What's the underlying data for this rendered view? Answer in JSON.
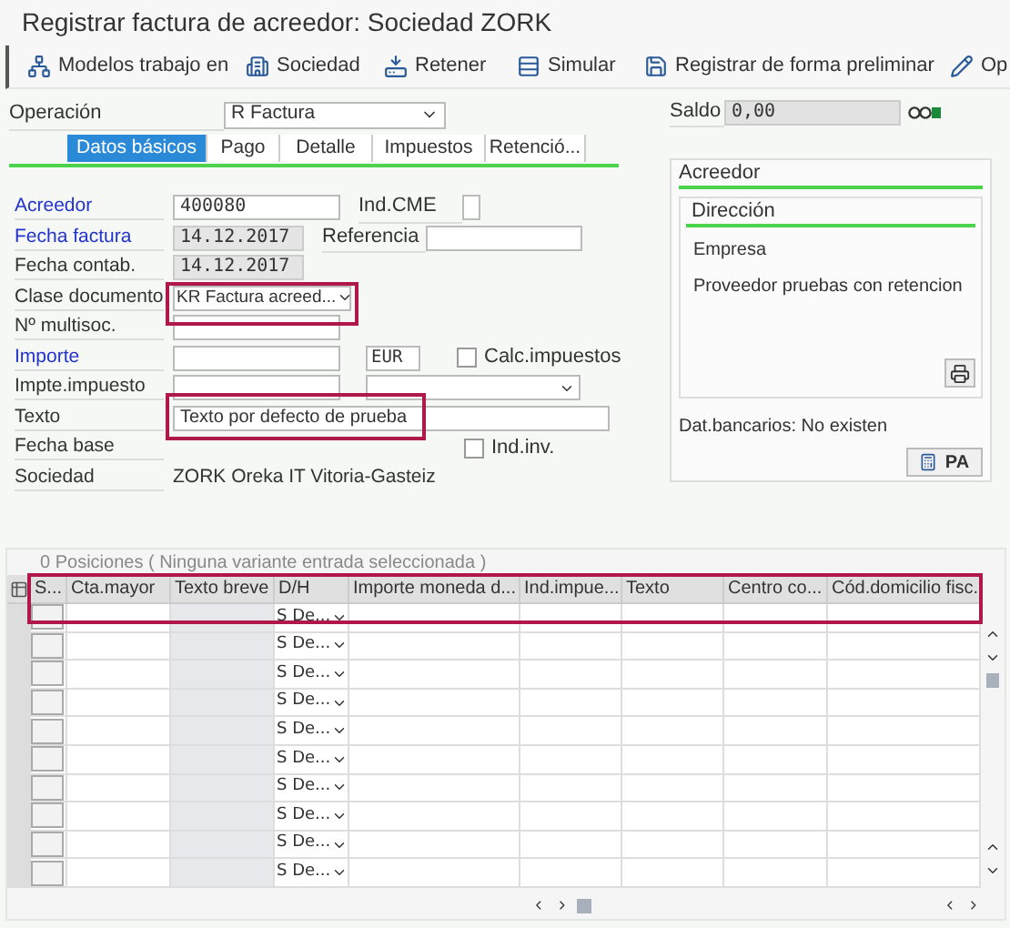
{
  "window": {
    "title": "Registrar factura de acreedor: Sociedad ZORK"
  },
  "toolbar": [
    {
      "label": "Modelos trabajo en"
    },
    {
      "label": "Sociedad"
    },
    {
      "label": "Retener"
    },
    {
      "label": "Simular"
    },
    {
      "label": "Registrar de forma preliminar"
    },
    {
      "label": "Op"
    }
  ],
  "operation": {
    "label": "Operación",
    "value": "R Factura"
  },
  "saldo": {
    "label": "Saldo",
    "value": "0,00"
  },
  "tabs": [
    {
      "label": "Datos básicos",
      "selected": true
    },
    {
      "label": "Pago",
      "selected": false
    },
    {
      "label": "Detalle",
      "selected": false
    },
    {
      "label": "Impuestos",
      "selected": false
    },
    {
      "label": "Retenció...",
      "selected": false
    }
  ],
  "form": [
    {
      "label": "Acreedor",
      "required": true,
      "kind": "input",
      "value": "400080",
      "extra": {
        "kind": "small-field",
        "label": "Ind.CME"
      }
    },
    {
      "label": "Fecha factura",
      "required": true,
      "kind": "date",
      "value": "14.12.2017",
      "extra": {
        "kind": "field",
        "label": "Referencia"
      }
    },
    {
      "label": "Fecha contab.",
      "required": false,
      "kind": "date",
      "value": "14.12.2017"
    },
    {
      "label": "Clase documento",
      "required": false,
      "kind": "select",
      "value": "KR Factura acreed..."
    },
    {
      "label": "Nº multisoc.",
      "required": false,
      "kind": "input"
    },
    {
      "label": "Importe",
      "required": true,
      "kind": "input",
      "extra": {
        "kind": "currency",
        "value": "EUR",
        "checkbox": {
          "label": "Calc.impuestos",
          "checked": false
        }
      }
    },
    {
      "label": "Impte.impuesto",
      "required": false,
      "kind": "input",
      "extra": {
        "kind": "select"
      }
    },
    {
      "label": "Texto",
      "required": false,
      "kind": "wide",
      "value": "Texto por defecto de prueba"
    },
    {
      "label": "Fecha base",
      "required": false,
      "kind": "none",
      "extra": {
        "kind": "checkbox",
        "checkbox": {
          "label": "Ind.inv.",
          "checked": false
        }
      }
    },
    {
      "label": "Sociedad",
      "required": false,
      "kind": "text",
      "value": "ZORK Oreka IT Vitoria-Gasteiz"
    }
  ],
  "vendor_panel": {
    "title": "Acreedor",
    "section": "Dirección",
    "lines": [
      "Empresa",
      "Proveedor pruebas con retencion"
    ],
    "bank": "Dat.bancarios: No existen",
    "button": "PA"
  },
  "table": {
    "caption": "0 Posiciones ( Ninguna variante entrada seleccionada )",
    "columns": [
      "S...",
      "Cta.mayor",
      "Texto breve",
      "D/H",
      "Importe moneda d...",
      "Ind.impue...",
      "Texto",
      "Centro co...",
      "Cód.domicilio fisc."
    ],
    "rows": [
      {
        "dh": "S De..."
      },
      {
        "dh": "S De..."
      },
      {
        "dh": "S De..."
      },
      {
        "dh": "S De..."
      },
      {
        "dh": "S De..."
      },
      {
        "dh": "S De..."
      },
      {
        "dh": "S De..."
      },
      {
        "dh": "S De..."
      },
      {
        "dh": "S De..."
      },
      {
        "dh": "S De..."
      }
    ]
  }
}
